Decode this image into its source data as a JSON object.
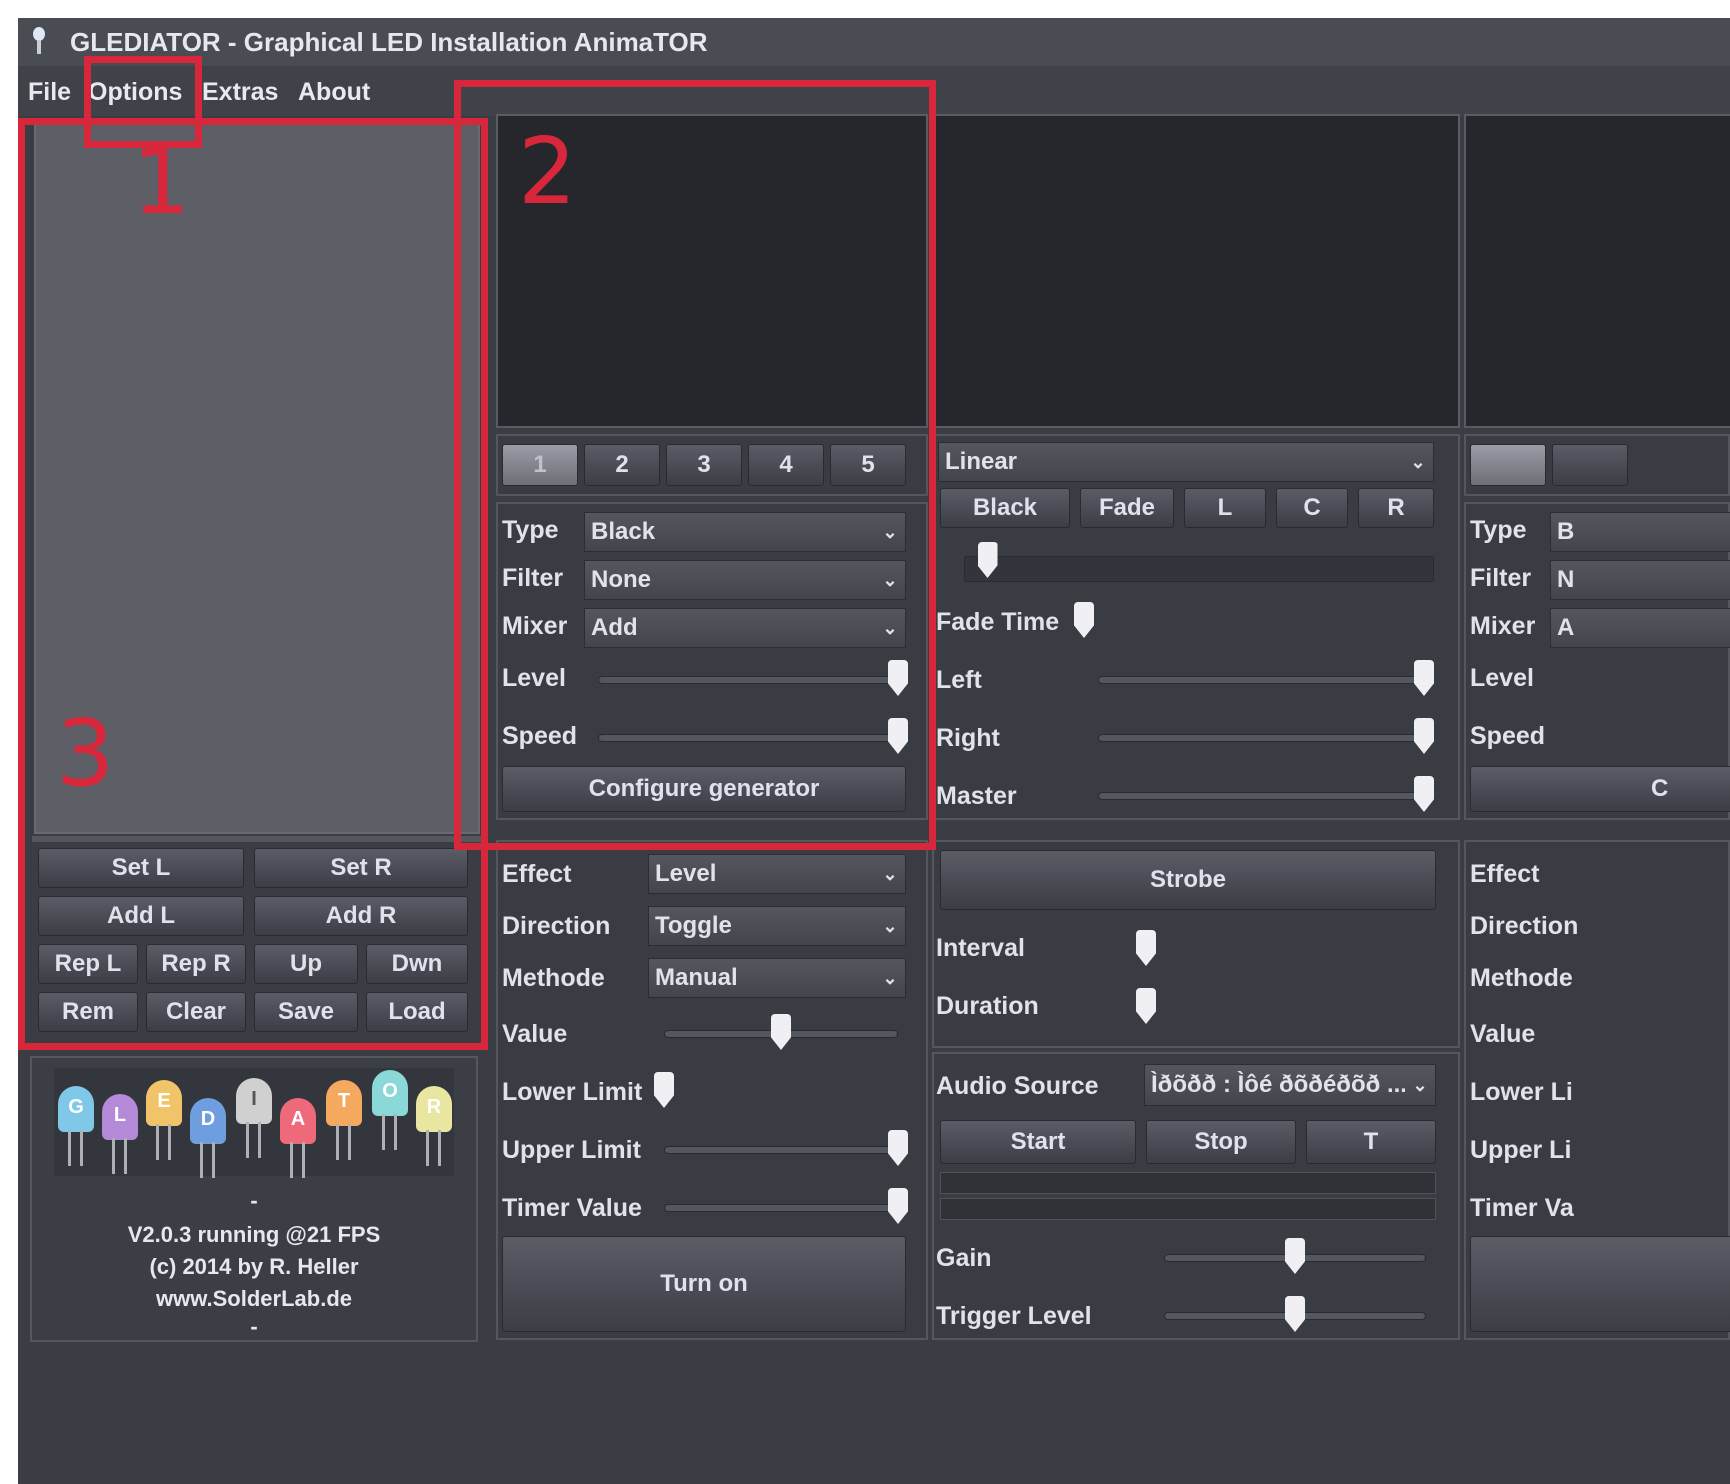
{
  "window": {
    "title": "GLEDIATOR - Graphical LED Installation AnimaTOR"
  },
  "menubar": {
    "items": [
      "File",
      "Options",
      "Extras",
      "About"
    ]
  },
  "annotations": [
    "1",
    "2",
    "3"
  ],
  "playlist": {
    "buttons_row1": [
      "Set L",
      "Set R"
    ],
    "buttons_row2": [
      "Add L",
      "Add R"
    ],
    "buttons_row3": [
      "Rep L",
      "Rep R",
      "Up",
      "Dwn"
    ],
    "buttons_row4": [
      "Rem",
      "Clear",
      "Save",
      "Load"
    ]
  },
  "logo": {
    "letters": [
      "G",
      "L",
      "E",
      "D",
      "I",
      "A",
      "T",
      "O",
      "R"
    ]
  },
  "footer": {
    "dash_top": "-",
    "version": "V2.0.3 running @21 FPS",
    "copyright": "(c) 2014 by R. Heller",
    "website": "www.SolderLab.de",
    "dash_bottom": "-"
  },
  "generator_left": {
    "tabs": [
      "1",
      "2",
      "3",
      "4",
      "5"
    ],
    "selected_tab": "1",
    "type_label": "Type",
    "type_value": "Black",
    "filter_label": "Filter",
    "filter_value": "None",
    "mixer_label": "Mixer",
    "mixer_value": "Add",
    "level_label": "Level",
    "level_value": 1.0,
    "speed_label": "Speed",
    "speed_value": 1.0,
    "configure_button": "Configure generator"
  },
  "crossfader": {
    "mode": "Linear",
    "buttons": [
      "Black",
      "Fade",
      "L",
      "C",
      "R"
    ],
    "position_value": 0.05,
    "fade_time_label": "Fade Time",
    "fade_time_value": 0.0,
    "left_label": "Left",
    "left_value": 1.0,
    "right_label": "Right",
    "right_value": 1.0,
    "master_label": "Master",
    "master_value": 1.0
  },
  "effect_left": {
    "effect_label": "Effect",
    "effect_value": "Level",
    "direction_label": "Direction",
    "direction_value": "Toggle",
    "methode_label": "Methode",
    "methode_value": "Manual",
    "value_label": "Value",
    "value_value": 0.5,
    "lower_label": "Lower Limit",
    "lower_value": 0.0,
    "upper_label": "Upper Limit",
    "upper_value": 1.0,
    "timer_label": "Timer Value",
    "timer_value": 1.0,
    "turn_on_button": "Turn on"
  },
  "strobe": {
    "button": "Strobe",
    "interval_label": "Interval",
    "interval_value": 0.0,
    "duration_label": "Duration",
    "duration_value": 0.0
  },
  "audio": {
    "source_label": "Audio Source",
    "source_value": "Ìðõðð : Ìôé ðõðéðõð ...",
    "start_button": "Start",
    "stop_button": "Stop",
    "t_button": "T",
    "gain_label": "Gain",
    "gain_value": 0.5,
    "trigger_label": "Trigger Level",
    "trigger_value": 0.5
  },
  "generator_right": {
    "type_label": "Type",
    "type_value": "B",
    "filter_label": "Filter",
    "filter_value": "N",
    "mixer_label": "Mixer",
    "mixer_value": "A",
    "level_label": "Level",
    "speed_label": "Speed",
    "configure_button": "C"
  },
  "effect_right": {
    "effect_label": "Effect",
    "direction_label": "Direction",
    "methode_label": "Methode",
    "value_label": "Value",
    "lower_label": "Lower Li",
    "upper_label": "Upper Li",
    "timer_label": "Timer Va"
  },
  "colors": {
    "accent_red": "#d8263a",
    "preview_bg": "#26272c",
    "panel_bg": "#3a3c44"
  }
}
